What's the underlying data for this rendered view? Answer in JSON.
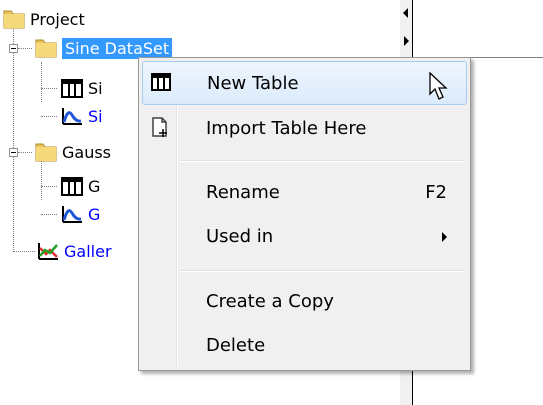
{
  "tree": {
    "root": {
      "label": "Project",
      "icon": "folder-icon"
    },
    "nodes": [
      {
        "label": "Sine DataSet",
        "icon": "folder-icon",
        "selected": true
      },
      {
        "label": "Si",
        "icon": "table-icon"
      },
      {
        "label": "Si",
        "icon": "plot-icon",
        "color": "#0000ff"
      },
      {
        "label": "Gauss",
        "icon": "folder-icon"
      },
      {
        "label": "G",
        "icon": "table-icon"
      },
      {
        "label": "G",
        "icon": "plot-icon",
        "color": "#0000ff"
      },
      {
        "label": "Galler",
        "icon": "gallery-plot-icon",
        "color": "#0000ff"
      }
    ]
  },
  "context_menu": {
    "items": [
      {
        "label": "New Table",
        "icon": "table-icon",
        "highlighted": true
      },
      {
        "label": "Import Table Here",
        "icon": "import-icon"
      },
      {
        "label": "Rename",
        "shortcut": "F2"
      },
      {
        "label": "Used in",
        "submenu": true
      },
      {
        "label": "Create a Copy"
      },
      {
        "label": "Delete"
      }
    ]
  },
  "colors": {
    "selection": "#3399ff",
    "link_blue": "#0000ff",
    "menu_bg": "#f0f0f0",
    "menu_hover_border": "#a8cbf1"
  }
}
